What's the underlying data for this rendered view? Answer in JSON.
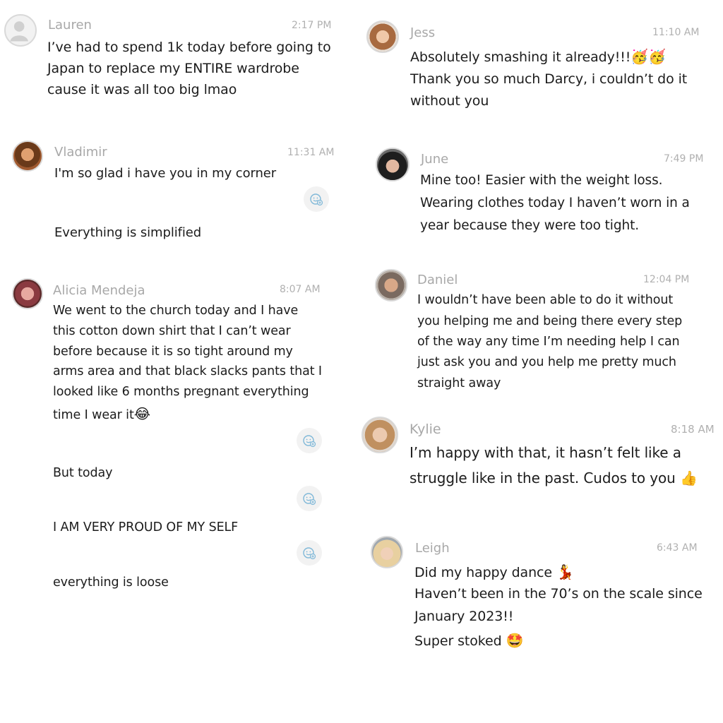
{
  "messages": [
    {
      "name": "Lauren",
      "time": "2:17 PM",
      "lines": [
        "I’ve had to spend 1k today before going to",
        "Japan to replace my ENTIRE wardrobe",
        "cause it was all too big lmao"
      ]
    },
    {
      "name": "Vladimir",
      "time": "11:31 AM",
      "lines": [
        "I'm so glad i have you in my corner"
      ],
      "extra": [
        "Everything is simplified"
      ]
    },
    {
      "name": "Alicia Mendeja",
      "time": "8:07 AM",
      "lines": [
        "We went to the church today and I have",
        "this cotton down shirt that I can’t wear",
        "before because it is so tight around my",
        "arms area and that black slacks pants that I",
        "looked like 6 months pregnant everything",
        "time I wear it"
      ],
      "extra": [
        "But today",
        "I AM VERY PROUD OF MY SELF",
        "everything is loose"
      ]
    },
    {
      "name": "Jess",
      "time": "11:10 AM",
      "lines": [
        "Absolutely smashing it already!!!",
        "Thank you so much Darcy, i couldn’t do it",
        "without you"
      ]
    },
    {
      "name": "June",
      "time": "7:49 PM",
      "lines": [
        "Mine too! Easier with the weight loss.",
        "Wearing clothes today I haven’t worn in a",
        "year because they were too tight."
      ]
    },
    {
      "name": "Daniel",
      "time": "12:04 PM",
      "lines": [
        "I wouldn’t have been able to do it without",
        "you helping me and being there every step",
        "of the way any time I’m needing help I can",
        "just ask you and you help me pretty much",
        "straight away"
      ]
    },
    {
      "name": "Kylie",
      "time": "8:18 AM",
      "lines": [
        "I’m happy with that, it hasn’t felt like a",
        "struggle like in the past. Cudos to you"
      ]
    },
    {
      "name": "Leigh",
      "time": "6:43 AM",
      "lines": [
        "Did my happy dance",
        "Haven’t been in the 70’s on the scale since",
        "January 2023!!",
        "Super stoked"
      ]
    }
  ],
  "emojis": {
    "tears_of_joy": "😂",
    "party_face": "🥳🥳",
    "thumbs_up": "👍",
    "dancer": "💃",
    "star_struck": "🤩"
  },
  "icons": {
    "add_reaction": "add-reaction-icon",
    "avatar_placeholder": "user-placeholder-icon"
  },
  "colors": {
    "name_text": "#a8a8a8",
    "time_text": "#b0b0b0",
    "body_text": "#1c1c1c",
    "reaction_icon": "#7fb8d8"
  }
}
